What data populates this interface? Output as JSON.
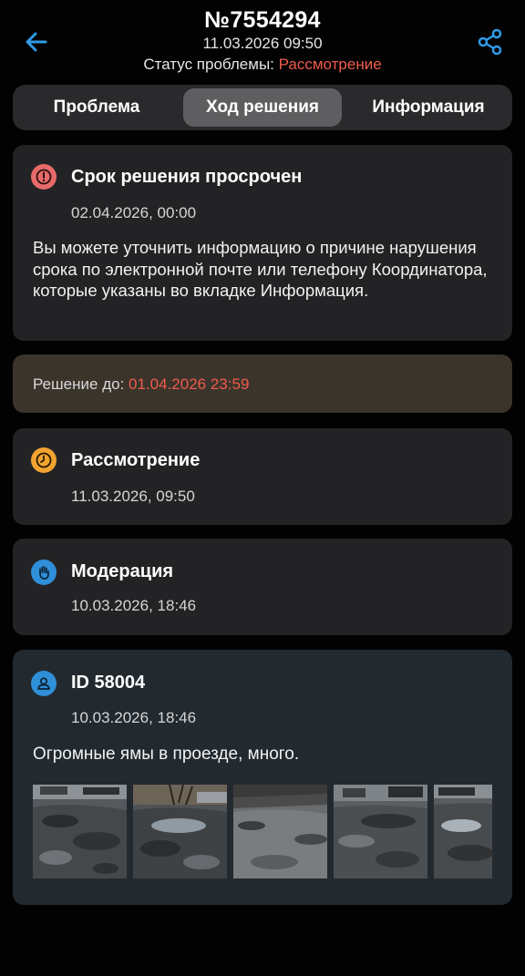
{
  "header": {
    "title": "№7554294",
    "datetime": "11.03.2026 09:50",
    "status_label": "Статус проблемы:",
    "status_value": "Рассмотрение",
    "back_icon": "arrow-left-icon",
    "share_icon": "share-icon",
    "accent_color": "#2f9be8",
    "status_color": "#ef5b4d"
  },
  "tabs": [
    {
      "label": "Проблема",
      "selected": false
    },
    {
      "label": "Ход решения",
      "selected": true
    },
    {
      "label": "Информация",
      "selected": false
    }
  ],
  "overdue": {
    "icon": "alert-icon",
    "icon_color": "#e86a6a",
    "title": "Срок решения просрочен",
    "date": "02.04.2026, 00:00",
    "text": "Вы можете уточнить информацию о причине нарушения срока по электронной почте или телефону Координатора, которые указаны во вкладке Информация."
  },
  "deadline": {
    "label": "Решение до:",
    "value": "01.04.2026 23:59"
  },
  "events": [
    {
      "icon": "clock-icon",
      "icon_color": "#f2a330",
      "title": "Рассмотрение",
      "date": "11.03.2026, 09:50"
    },
    {
      "icon": "hand-icon",
      "icon_color": "#2f8fd8",
      "title": "Модерация",
      "date": "10.03.2026, 18:46"
    }
  ],
  "user_event": {
    "icon": "user-icon",
    "icon_color": "#2f8fd8",
    "title": "ID 58004",
    "date": "10.03.2026, 18:46",
    "comment": "Огромные ямы в проезде, много.",
    "photo_count_visible": 5
  }
}
